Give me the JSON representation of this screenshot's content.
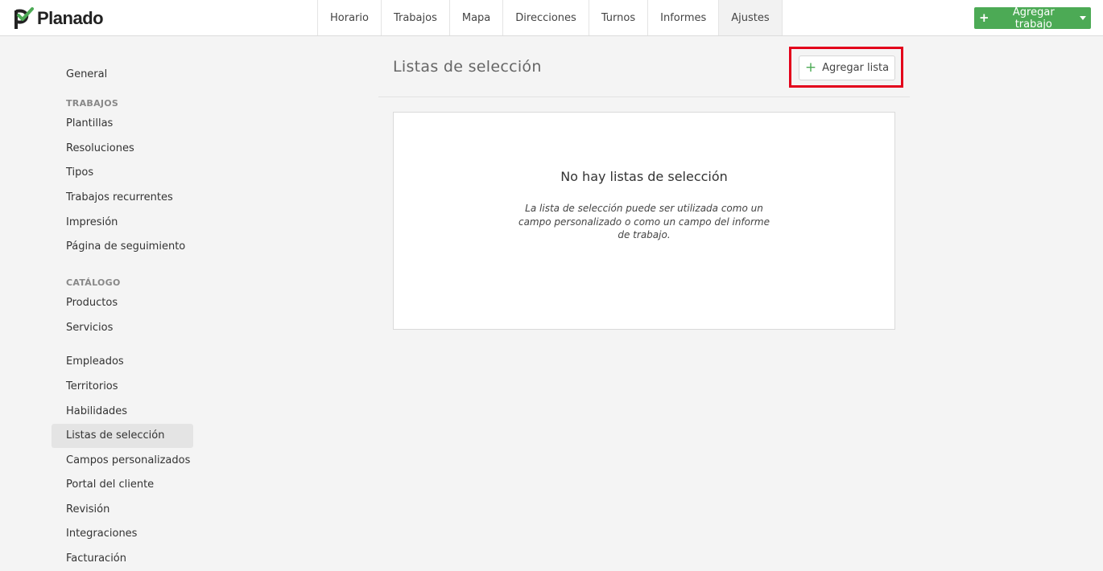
{
  "app": {
    "name": "Planado"
  },
  "nav": {
    "items": [
      {
        "label": "Horario"
      },
      {
        "label": "Trabajos"
      },
      {
        "label": "Mapa"
      },
      {
        "label": "Direcciones"
      },
      {
        "label": "Turnos"
      },
      {
        "label": "Informes"
      },
      {
        "label": "Ajustes"
      }
    ],
    "active": "Ajustes",
    "add_job_label": "Agregar trabajo"
  },
  "sidebar": {
    "general": "General",
    "section_trabajos": "TRABAJOS",
    "trabajos": [
      "Plantillas",
      "Resoluciones",
      "Tipos",
      "Trabajos recurrentes",
      "Impresión",
      "Página de seguimiento"
    ],
    "section_catalogo": "CATÁLOGO",
    "catalogo": [
      "Productos",
      "Servicios"
    ],
    "other": [
      "Empleados",
      "Territorios",
      "Habilidades",
      "Listas de selección",
      "Campos personalizados",
      "Portal del cliente",
      "Revisión",
      "Integraciones",
      "Facturación"
    ],
    "active": "Listas de selección"
  },
  "main": {
    "title": "Listas de selección",
    "add_list_label": "Agregar lista",
    "empty_title": "No hay listas de selección",
    "empty_desc": "La lista de selección puede ser utilizada como un campo personalizado o como un campo del informe de trabajo."
  },
  "colors": {
    "brand_green": "#4caa55",
    "highlight_red": "#e3001b"
  },
  "icons": {
    "logo": "planado-check-logo",
    "plus": "plus-icon",
    "caret": "caret-down-icon"
  }
}
